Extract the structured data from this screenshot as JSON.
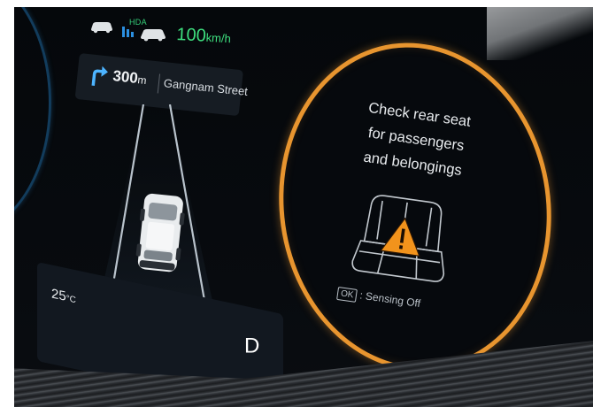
{
  "adas": {
    "hda_label": "HDA",
    "set_speed": "100",
    "set_speed_unit": "km/h",
    "accent_color": "#3ee07f",
    "icons": [
      "lead-car-icon",
      "lane-assist-icon",
      "own-car-icon"
    ]
  },
  "navigation": {
    "turn_icon": "turn-right-arrow-icon",
    "distance": "300",
    "distance_unit": "m",
    "street": "Gangnam Street"
  },
  "status": {
    "temperature": "25",
    "temperature_unit": "°C",
    "gear": "D"
  },
  "alert": {
    "message": "Check rear seat\nfor passengers\nand belongings",
    "icon": "rear-seat-warning-icon",
    "ok_label": "OK",
    "ok_action": ": Sensing Off",
    "ring_color": "#e8952f"
  }
}
